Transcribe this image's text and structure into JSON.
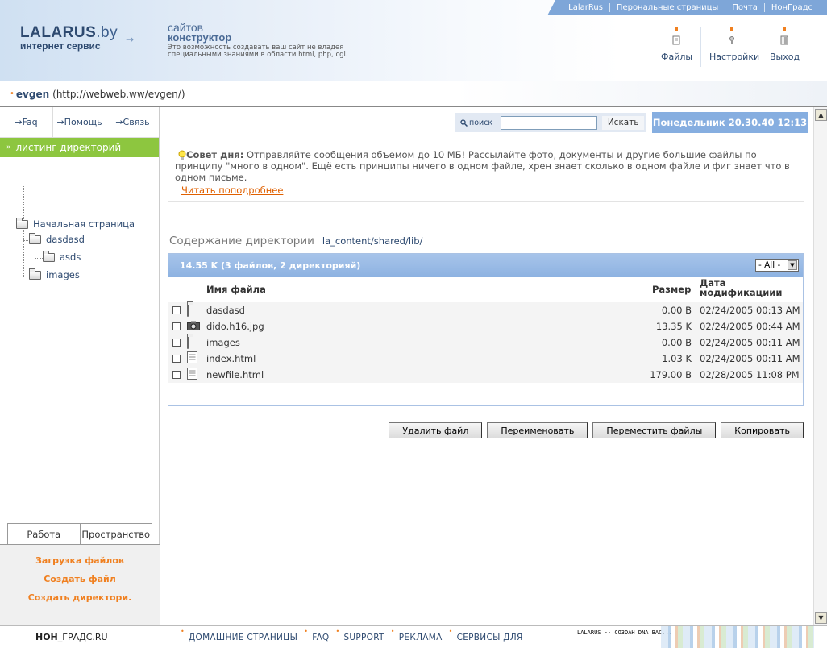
{
  "top_links": [
    "LalarRus",
    "Перональные страницы",
    "Почта",
    "НонГрадс"
  ],
  "logo": {
    "brand_main": "LALARUS",
    "brand_suffix": ".by",
    "subtitle": "интернет сервис"
  },
  "slogan": {
    "line1": "сайтов",
    "line2": "конструктор",
    "line3": "Это возможность создавать ваш сайт не владея специальными знаниями в области html, php, cgi."
  },
  "header_buttons": [
    {
      "label": "Файлы",
      "icon": "file-icon"
    },
    {
      "label": "Настройки",
      "icon": "settings-icon"
    },
    {
      "label": "Выход",
      "icon": "exit-icon"
    }
  ],
  "user": {
    "name": "evgen",
    "url": "(http://webweb.ww/evgen/)"
  },
  "sidebar": {
    "nav": [
      {
        "label": "Faq",
        "arrow": "→"
      },
      {
        "label": "Помощь",
        "arrow": "→"
      },
      {
        "label": "Связь",
        "arrow": "→"
      }
    ],
    "title": "листинг директорий",
    "tree": [
      "Начальная страница",
      "dasdasd",
      "asds",
      "images"
    ],
    "tabs": [
      "Работа",
      "Пространство"
    ],
    "links": [
      "Загрузка файлов",
      "Создать файл",
      "Создать директори."
    ]
  },
  "search": {
    "label": "поиск",
    "value": "",
    "button": "Искать"
  },
  "datetime": "Понедельник 20.30.40 12:13",
  "tip": {
    "title": "Совет дня:",
    "text": "Отправляйте сообщения объемом до 10 МБ! Рассылайте фото, документы и другие большие файлы по принципу \"много в одном\". Ещё есть принципы ничего в одном файле, хрен знает сколько в одном файле и фиг знает что в одном письме.",
    "link": "Читать поподробнее"
  },
  "directory": {
    "heading": "Содержание директории",
    "path": "la_content/shared/lib/",
    "summary": "14.55 K (3 файлов, 2 директорияй)",
    "filter": "- All -",
    "columns": {
      "name": "Имя файла",
      "size": "Размер",
      "date_line1": "Дата",
      "date_line2": "модификациии"
    },
    "files": [
      {
        "name": "dasdasd",
        "size": "0.00 B",
        "date": "02/24/2005 00:13 AM",
        "type": "folder"
      },
      {
        "name": "dido.h16.jpg",
        "size": "13.35 K",
        "date": "02/24/2005 00:44 AM",
        "type": "image"
      },
      {
        "name": "images",
        "size": "0.00 B",
        "date": "02/24/2005 00:11 AM",
        "type": "folder"
      },
      {
        "name": "index.html",
        "size": "1.03 K",
        "date": "02/24/2005 00:11 AM",
        "type": "document"
      },
      {
        "name": "newfile.html",
        "size": "179.00 B",
        "date": "02/28/2005 11:08 PM",
        "type": "document"
      }
    ]
  },
  "actions": [
    "Удалить файл",
    "Переименовать",
    "Переместить файлы",
    "Копировать"
  ],
  "footer": {
    "brand_bold": "НОН",
    "brand_rest": "_ГРАДС.RU",
    "links": [
      "ДОМАШНИЕ СТРАНИЦЫ",
      "FAQ",
      "SUPPORT",
      "РЕКЛАМА",
      "СЕРВИСЫ ДЛЯ"
    ],
    "ad": "LALARUS -- CO3DAH DNA BAC..."
  },
  "colors": {
    "accent_green": "#8dc63f",
    "accent_orange": "#f08020",
    "accent_blue": "#86aee0",
    "brand_navy": "#2e4a70"
  }
}
